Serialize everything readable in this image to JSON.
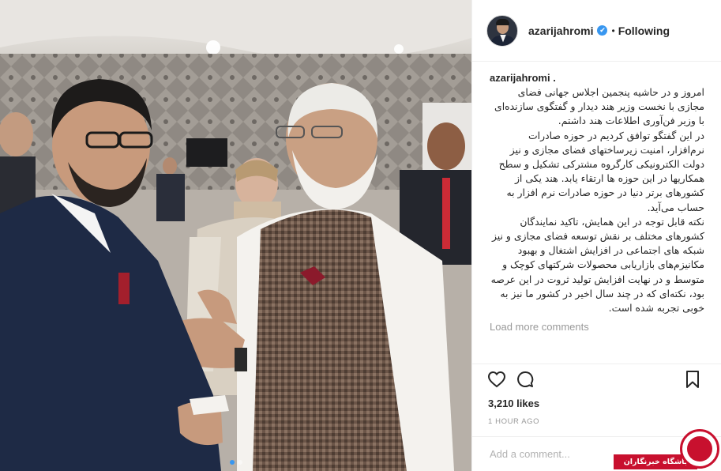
{
  "post": {
    "username": "azarijahromi",
    "follow_status": "Following",
    "separator": "•",
    "verified_mark": "✔"
  },
  "caption": {
    "username": "azarijahromi .",
    "text": "امروز و در حاشیه پنجمین اجلاس جهانی فضای مجازی با نخست وزیر هند دیدار و گفتگوی سازنده‌ای با وزیر فن‌آوری اطلاعات هند داشتم.\nدر این گفتگو توافق کردیم در حوزه صادرات نرم‌افزار، امنیت زیرساختهای فضای مجازی و نیز دولت الکترونیکی کارگروه مشترکی تشکیل و سطح همکاریها در این حوزه ها ارتقاء یابد. هند یکی از کشورهای برتر دنیا در حوزه صادرات نرم افزار به حساب می‌آید.\nنکته قابل توجه در این همایش، تاکید نمایندگان کشورهای مختلف بر نقش توسعه فضای مجازی و نیز شبکه های اجتماعی در افزایش اشتغال و بهبود مکانیزم‌های بازاریابی محصولات شرکتهای کوچک و متوسط و در نهایت افزایش تولید ثروت در این عرصه بود، نکته‌ای که در چند سال اخیر در کشور ما نیز به خوبی تجربه شده است."
  },
  "load_more": "Load more comments",
  "likes": "3,210 likes",
  "timestamp": "1 HOUR AGO",
  "add_comment_placeholder": "Add a comment...",
  "watermark": "باشگاه خبرنگاران",
  "icons": {
    "like": "heart-icon",
    "comment": "comment-bubble-icon",
    "save": "bookmark-icon"
  },
  "carousel": {
    "count": 2,
    "active_index": 0
  },
  "colors": {
    "accent_blue": "#3897f0",
    "muted_text": "#999999",
    "border": "#efefef",
    "watermark_red": "#c8102e"
  }
}
